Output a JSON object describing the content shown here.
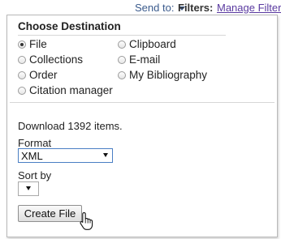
{
  "topbar": {
    "send_to_label": "Send to:",
    "filters_label": "Filters:",
    "filters_link": "Manage Filters"
  },
  "popup": {
    "title": "Choose Destination",
    "destinations": [
      {
        "label": "File",
        "checked": true
      },
      {
        "label": "Clipboard",
        "checked": false
      },
      {
        "label": "Collections",
        "checked": false
      },
      {
        "label": "E-mail",
        "checked": false
      },
      {
        "label": "Order",
        "checked": false
      },
      {
        "label": "My Bibliography",
        "checked": false
      },
      {
        "label": "Citation manager",
        "checked": false
      }
    ],
    "download_text": "Download 1392 items.",
    "format_label": "Format",
    "format_value": "XML",
    "sort_label": "Sort by",
    "sort_value": "",
    "create_button": "Create File"
  },
  "icons": {
    "send_to_caret": "chevron-down-icon",
    "cursor": "hand-pointer-icon"
  },
  "colors": {
    "link_blue": "#3a5a8c",
    "link_visited": "#5a3aa0",
    "select_focus_border": "#4a7fc4"
  }
}
